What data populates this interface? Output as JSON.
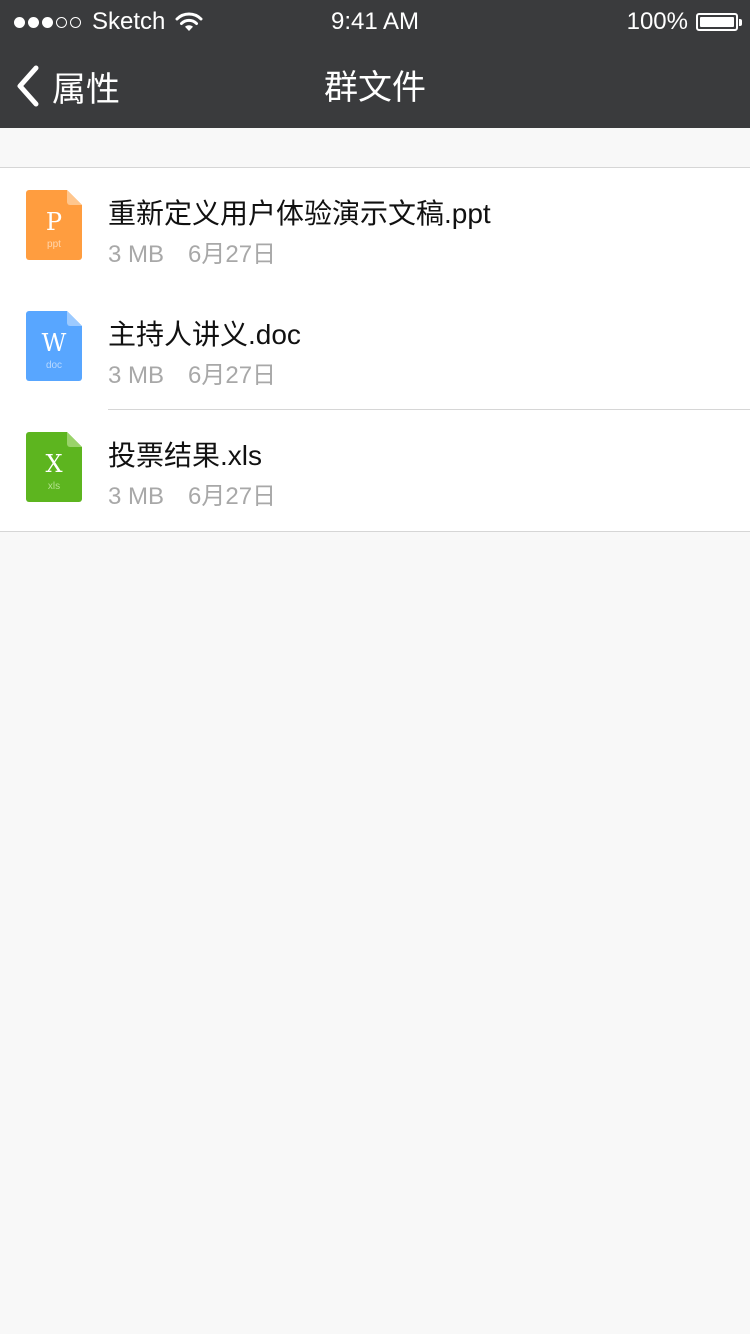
{
  "status_bar": {
    "signal_dots_filled": 3,
    "signal_dots_total": 5,
    "carrier": "Sketch",
    "time": "9:41 AM",
    "battery_percent": "100%",
    "wifi_icon": "wifi-icon",
    "battery_icon": "battery-icon"
  },
  "nav": {
    "back_label": "属性",
    "title": "群文件",
    "back_icon": "chevron-left-icon"
  },
  "colors": {
    "nav_background": "#3a3b3d",
    "page_background": "#f8f8f8",
    "ppt": "#ff9d3f",
    "doc": "#58a6ff",
    "xls": "#5db51f"
  },
  "files": [
    {
      "name": "重新定义用户体验演示文稿.ppt",
      "size": "3 MB",
      "date": "6月27日",
      "icon": {
        "letter": "P",
        "ext": "ppt",
        "name": "ppt-file-icon"
      }
    },
    {
      "name": "主持人讲义.doc",
      "size": "3 MB",
      "date": "6月27日",
      "icon": {
        "letter": "W",
        "ext": "doc",
        "name": "doc-file-icon"
      }
    },
    {
      "name": "投票结果.xls",
      "size": "3 MB",
      "date": "6月27日",
      "icon": {
        "letter": "X",
        "ext": "xls",
        "name": "xls-file-icon"
      }
    }
  ]
}
